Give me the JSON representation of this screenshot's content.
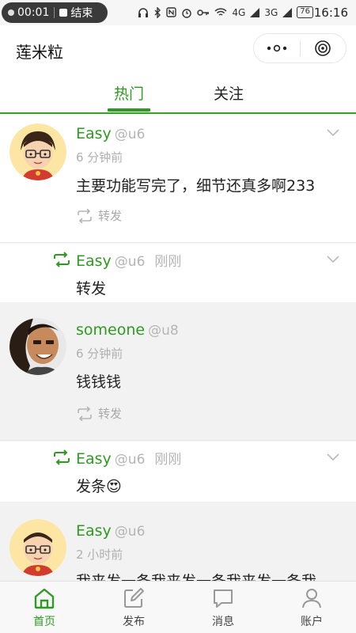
{
  "status_bar": {
    "record_time": "00:01",
    "record_end": "结束",
    "network": "4G",
    "network2": "3G",
    "battery": "76",
    "clock": "16:16"
  },
  "app": {
    "title": "莲米粒"
  },
  "tabs": [
    {
      "label": "热门"
    },
    {
      "label": "关注"
    }
  ],
  "feed": [
    {
      "name": "Easy",
      "handle": "@u6",
      "time": "6 分钟前",
      "text": "主要功能写完了，细节还真多啊233",
      "action": "转发"
    },
    {
      "name": "Easy",
      "handle": "@u6",
      "time": "刚刚",
      "text": "转发"
    },
    {
      "name": "someone",
      "handle": "@u8",
      "time": "6 分钟前",
      "text": "钱钱钱",
      "action": "转发"
    },
    {
      "name": "Easy",
      "handle": "@u6",
      "time": "刚刚",
      "text": "发条😍"
    },
    {
      "name": "Easy",
      "handle": "@u6",
      "time": "2 小时前",
      "text": "我来发一条我来发一条我来发一条我"
    }
  ],
  "bottom_nav": [
    {
      "label": "首页",
      "icon": "home-icon"
    },
    {
      "label": "发布",
      "icon": "edit-icon"
    },
    {
      "label": "消息",
      "icon": "message-icon"
    },
    {
      "label": "账户",
      "icon": "user-icon"
    }
  ],
  "colors": {
    "accent": "#2f9a22",
    "muted": "#b0b0b0"
  }
}
